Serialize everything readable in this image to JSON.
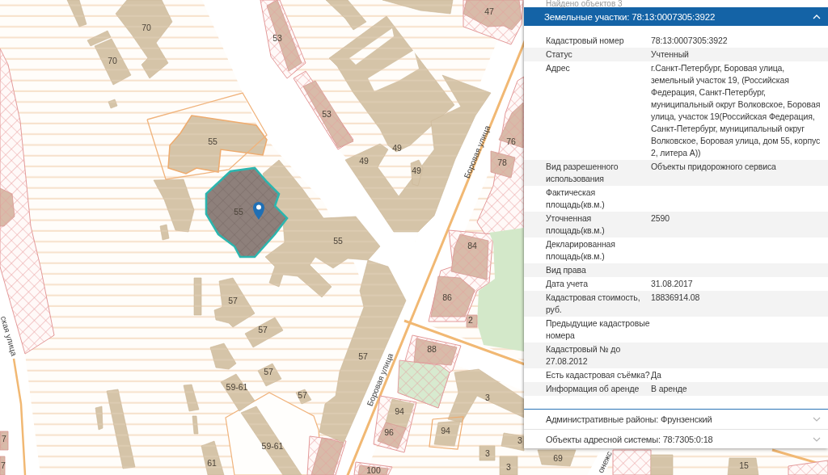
{
  "map": {
    "street_names": [
      {
        "text": "Боровая улица"
      },
      {
        "text": "Боровая улица"
      },
      {
        "text": "ская улица"
      },
      {
        "text": "онежс"
      }
    ],
    "house_numbers": [
      {
        "text": "47"
      },
      {
        "text": "70"
      },
      {
        "text": "53"
      },
      {
        "text": "70"
      },
      {
        "text": "53"
      },
      {
        "text": "55"
      },
      {
        "text": "76"
      },
      {
        "text": "49"
      },
      {
        "text": "49"
      },
      {
        "text": "78"
      },
      {
        "text": "49"
      },
      {
        "text": "55"
      },
      {
        "text": "55"
      },
      {
        "text": "84"
      },
      {
        "text": "86"
      },
      {
        "text": "57"
      },
      {
        "text": "2"
      },
      {
        "text": "57"
      },
      {
        "text": "88"
      },
      {
        "text": "57"
      },
      {
        "text": "57"
      },
      {
        "text": "59-61"
      },
      {
        "text": "57"
      },
      {
        "text": "3"
      },
      {
        "text": "94"
      },
      {
        "text": "7"
      },
      {
        "text": "96"
      },
      {
        "text": "94"
      },
      {
        "text": "3"
      },
      {
        "text": "59-61"
      },
      {
        "text": "3"
      },
      {
        "text": "7"
      },
      {
        "text": "61"
      },
      {
        "text": "100"
      },
      {
        "text": "3"
      },
      {
        "text": "69"
      },
      {
        "text": "15"
      }
    ]
  },
  "results_count": "Найдено объектов 3",
  "sections": [
    {
      "title": "Земельные участки: 78:13:0007305:3922",
      "expanded": true,
      "rows": [
        {
          "label": "Кадастровый номер",
          "value": "78:13:0007305:3922"
        },
        {
          "label": "Статус",
          "value": "Учтенный"
        },
        {
          "label": "Адрес",
          "value": "г.Санкт-Петербург, Боровая улица, земельный участок 19, (Российская Федерация, Санкт-Петербург, муниципальный округ Волковское, Боровая улица, участок 19(Российская Федерация, Санкт-Петербург, муниципальный округ Волковское, Боровая улица, дом 55, корпус 2, литера А))"
        },
        {
          "label": "Вид разрешенного использования",
          "value": "Объекты придорожного сервиса"
        },
        {
          "label": "Фактическая площадь(кв.м.)"
        },
        {
          "label": "Уточненная площадь(кв.м.)",
          "value": "2590"
        },
        {
          "label": "Декларированная площадь(кв.м.)"
        },
        {
          "label": "Вид права"
        },
        {
          "label": "Дата учета",
          "value": "31.08.2017"
        },
        {
          "label": "Кадастровая стоимость, руб.",
          "value": "18836914.08"
        },
        {
          "label": "Предыдущие кадастровые номера"
        },
        {
          "label": "Кадастровый № до 27.08.2012"
        },
        {
          "label": "Есть кадастровая съёмка?",
          "value": "Да"
        },
        {
          "label": "Информация об аренде",
          "value": "В аренде"
        }
      ]
    },
    {
      "title": "Административные районы: Фрунзенский",
      "expanded": false
    },
    {
      "title": "Объекты адресной системы: 78:7305:0:18",
      "expanded": false
    }
  ]
}
